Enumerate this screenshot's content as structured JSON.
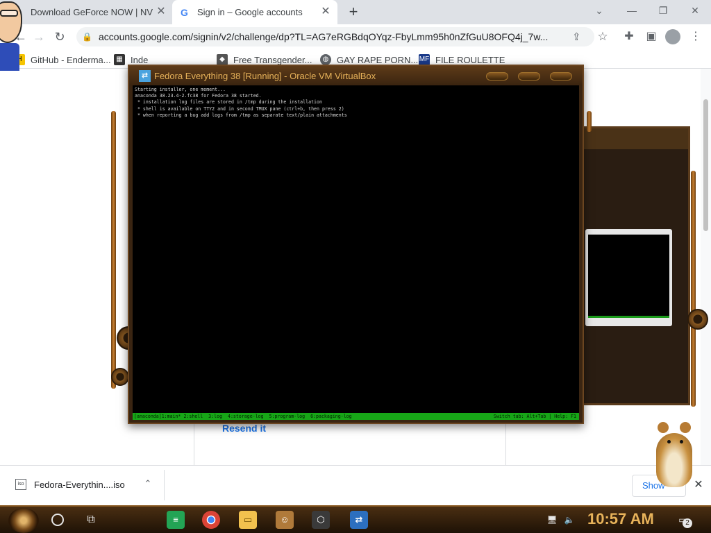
{
  "browser": {
    "tabs": [
      {
        "title": "Download GeForce NOW | NVI",
        "state": "inactive"
      },
      {
        "title": "Sign in – Google accounts",
        "state": "active",
        "favicon": "G"
      }
    ],
    "toolbar": {
      "url": "accounts.google.com/signin/v2/challenge/dp?TL=AG7eRGBdqOYqz-FbyLmm95h0nZfGuU8OFQ4j_7w..."
    },
    "bookmarks": [
      {
        "label": "GitHub - Enderma...",
        "icon": "github-icon"
      },
      {
        "label": "Inde",
        "icon": "index-icon"
      },
      {
        "label": "Free Transgender...",
        "icon": "site-icon"
      },
      {
        "label": "GAY RAPE PORN...",
        "icon": "globe-icon"
      },
      {
        "label": "FILE ROULETTE",
        "icon": "file-roulette-icon"
      }
    ]
  },
  "google_page": {
    "resend_link": "Resend it"
  },
  "virtualbox": {
    "title": "Fedora Everything 38 [Running] - Oracle VM VirtualBox",
    "console_lines": [
      "Starting installer, one moment...",
      "anaconda 38.23.4-2.fc38 for Fedora 38 started.",
      " * installation log files are stored in /tmp during the installation",
      " * shell is available on TTY2 and in second TMUX pane (ctrl+b, then press 2)",
      " * when reporting a bug add logs from /tmp as separate text/plain attachments"
    ],
    "statusbar_left": "[anaconda]1:main* 2:shell  3:log  4:storage-log  5:program-log  6:packaging-log",
    "statusbar_right": "Switch tab: Alt+Tab | Help: F1"
  },
  "downloads": {
    "file_name": "Fedora-Everythin....iso",
    "file_icon_text": "iso",
    "show_all_label": "Show"
  },
  "taskbar": {
    "clock": "10:57 AM",
    "notification_count": "2"
  },
  "colors": {
    "chrome_tabstrip": "#dee1e6",
    "google_link": "#1a73e8",
    "terminal_status_green": "#17a617",
    "steampunk_brown": "#3a2512",
    "clock_gold": "#e8b35a"
  }
}
